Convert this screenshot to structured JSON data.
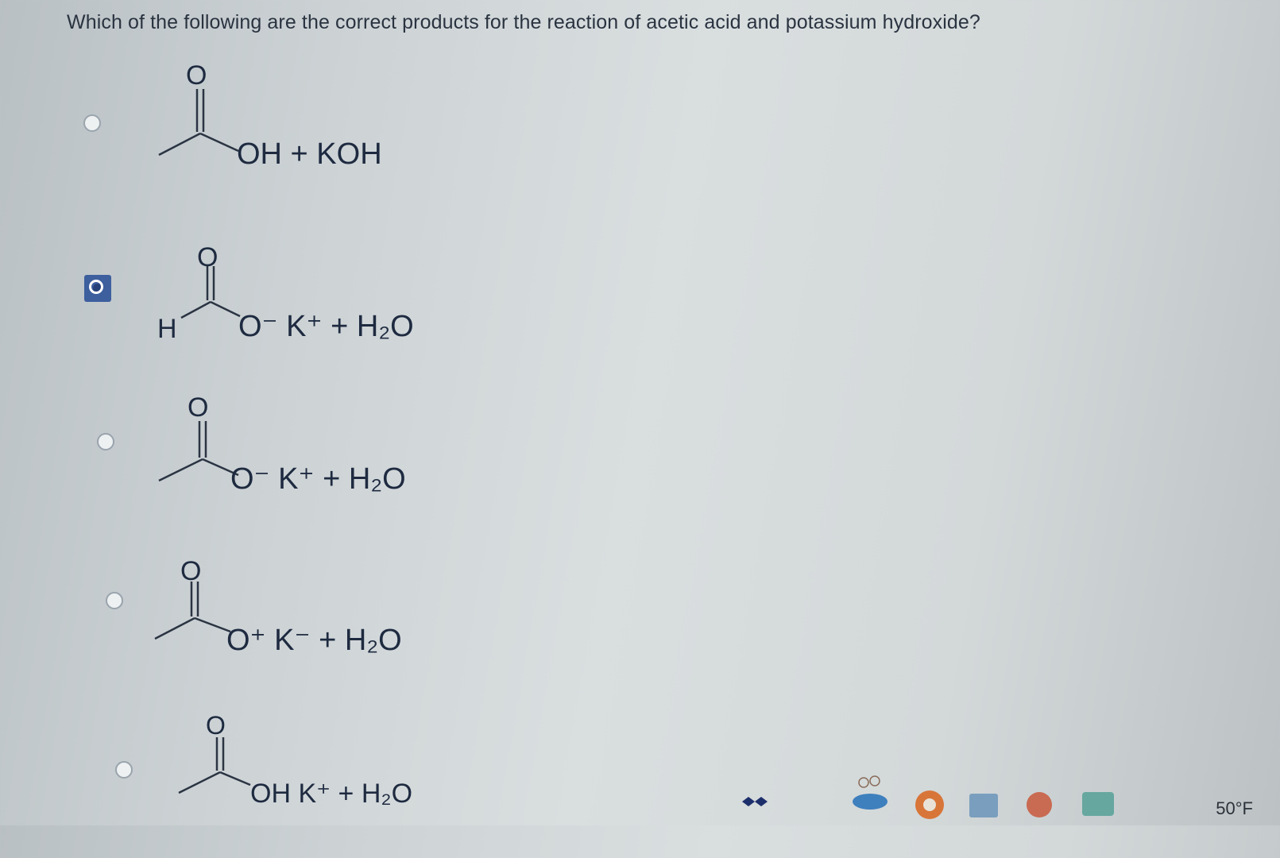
{
  "question": "Which of the following are the correct products for the reaction of acetic acid and potassium hydroxide?",
  "options": [
    {
      "selected": false,
      "atom_o": "O",
      "left_label": "",
      "right_text": "OH + KOH"
    },
    {
      "selected": true,
      "atom_o": "O",
      "left_label": "H",
      "right_text": "O⁻ K⁺ + H₂O"
    },
    {
      "selected": false,
      "atom_o": "O",
      "left_label": "",
      "right_text": "O⁻ K⁺ + H₂O"
    },
    {
      "selected": false,
      "atom_o": "O",
      "left_label": "",
      "right_text": "O⁺ K⁻ + H₂O"
    },
    {
      "selected": false,
      "atom_o": "O",
      "left_label": "",
      "right_text": "OH K⁺ + H₂O"
    }
  ],
  "taskbar": {
    "weather": "50°F",
    "icons": [
      "dropbox-icon",
      "chrome-icon",
      "edge-icon",
      "people-icon",
      "word-icon",
      "file-explorer-icon"
    ]
  }
}
